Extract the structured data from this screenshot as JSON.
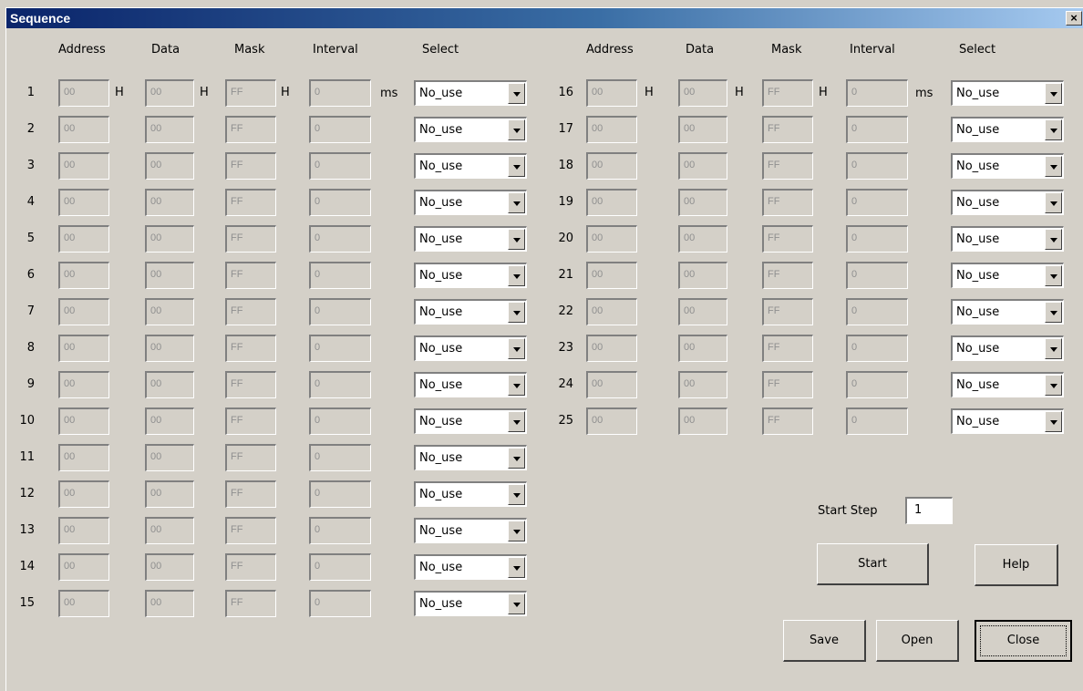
{
  "window": {
    "title": "Sequence",
    "close_glyph": "×"
  },
  "headers": {
    "address": "Address",
    "data": "Data",
    "mask": "Mask",
    "interval": "Interval",
    "select": "Select"
  },
  "units": {
    "hex": "H",
    "ms": "ms"
  },
  "rows": [
    {
      "num": "1",
      "address": "00",
      "data": "00",
      "mask": "FF",
      "interval": "0",
      "select": "No_use"
    },
    {
      "num": "2",
      "address": "00",
      "data": "00",
      "mask": "FF",
      "interval": "0",
      "select": "No_use"
    },
    {
      "num": "3",
      "address": "00",
      "data": "00",
      "mask": "FF",
      "interval": "0",
      "select": "No_use"
    },
    {
      "num": "4",
      "address": "00",
      "data": "00",
      "mask": "FF",
      "interval": "0",
      "select": "No_use"
    },
    {
      "num": "5",
      "address": "00",
      "data": "00",
      "mask": "FF",
      "interval": "0",
      "select": "No_use"
    },
    {
      "num": "6",
      "address": "00",
      "data": "00",
      "mask": "FF",
      "interval": "0",
      "select": "No_use"
    },
    {
      "num": "7",
      "address": "00",
      "data": "00",
      "mask": "FF",
      "interval": "0",
      "select": "No_use"
    },
    {
      "num": "8",
      "address": "00",
      "data": "00",
      "mask": "FF",
      "interval": "0",
      "select": "No_use"
    },
    {
      "num": "9",
      "address": "00",
      "data": "00",
      "mask": "FF",
      "interval": "0",
      "select": "No_use"
    },
    {
      "num": "10",
      "address": "00",
      "data": "00",
      "mask": "FF",
      "interval": "0",
      "select": "No_use"
    },
    {
      "num": "11",
      "address": "00",
      "data": "00",
      "mask": "FF",
      "interval": "0",
      "select": "No_use"
    },
    {
      "num": "12",
      "address": "00",
      "data": "00",
      "mask": "FF",
      "interval": "0",
      "select": "No_use"
    },
    {
      "num": "13",
      "address": "00",
      "data": "00",
      "mask": "FF",
      "interval": "0",
      "select": "No_use"
    },
    {
      "num": "14",
      "address": "00",
      "data": "00",
      "mask": "FF",
      "interval": "0",
      "select": "No_use"
    },
    {
      "num": "15",
      "address": "00",
      "data": "00",
      "mask": "FF",
      "interval": "0",
      "select": "No_use"
    },
    {
      "num": "16",
      "address": "00",
      "data": "00",
      "mask": "FF",
      "interval": "0",
      "select": "No_use"
    },
    {
      "num": "17",
      "address": "00",
      "data": "00",
      "mask": "FF",
      "interval": "0",
      "select": "No_use"
    },
    {
      "num": "18",
      "address": "00",
      "data": "00",
      "mask": "FF",
      "interval": "0",
      "select": "No_use"
    },
    {
      "num": "19",
      "address": "00",
      "data": "00",
      "mask": "FF",
      "interval": "0",
      "select": "No_use"
    },
    {
      "num": "20",
      "address": "00",
      "data": "00",
      "mask": "FF",
      "interval": "0",
      "select": "No_use"
    },
    {
      "num": "21",
      "address": "00",
      "data": "00",
      "mask": "FF",
      "interval": "0",
      "select": "No_use"
    },
    {
      "num": "22",
      "address": "00",
      "data": "00",
      "mask": "FF",
      "interval": "0",
      "select": "No_use"
    },
    {
      "num": "23",
      "address": "00",
      "data": "00",
      "mask": "FF",
      "interval": "0",
      "select": "No_use"
    },
    {
      "num": "24",
      "address": "00",
      "data": "00",
      "mask": "FF",
      "interval": "0",
      "select": "No_use"
    },
    {
      "num": "25",
      "address": "00",
      "data": "00",
      "mask": "FF",
      "interval": "0",
      "select": "No_use"
    }
  ],
  "start_step": {
    "label": "Start Step",
    "value": "1"
  },
  "buttons": {
    "start": "Start",
    "help": "Help",
    "save": "Save",
    "open": "Open",
    "close": "Close"
  }
}
